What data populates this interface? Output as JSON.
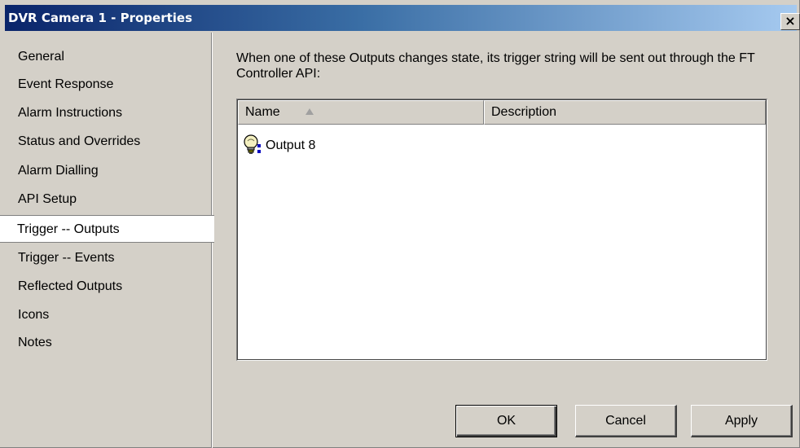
{
  "window": {
    "title": "DVR Camera 1 - Properties",
    "close_label": "×"
  },
  "nav": {
    "items": [
      {
        "label": "General"
      },
      {
        "label": "Event Response"
      },
      {
        "label": "Alarm Instructions"
      },
      {
        "label": "Status and Overrides"
      },
      {
        "label": "Alarm Dialling"
      },
      {
        "label": "API Setup"
      },
      {
        "label": "Trigger -- Outputs"
      },
      {
        "label": "Trigger -- Events"
      },
      {
        "label": "Reflected Outputs"
      },
      {
        "label": "Icons"
      },
      {
        "label": "Notes"
      }
    ],
    "selected": "Trigger -- Outputs"
  },
  "main": {
    "description": "When one of these Outputs changes state, its trigger string will be sent out through the FT Controller API:",
    "columns": [
      {
        "label": "Name",
        "sort": "ascending"
      },
      {
        "label": "Description"
      }
    ],
    "rows": [
      {
        "name": "Output 8",
        "description": "",
        "icon": "light-bulb-icon"
      }
    ]
  },
  "buttons": {
    "ok": "OK",
    "cancel": "Cancel",
    "apply": "Apply"
  },
  "colors": {
    "titlebar_start": "#0a246a",
    "titlebar_end": "#a6caf0",
    "face": "#d4d0c8"
  }
}
